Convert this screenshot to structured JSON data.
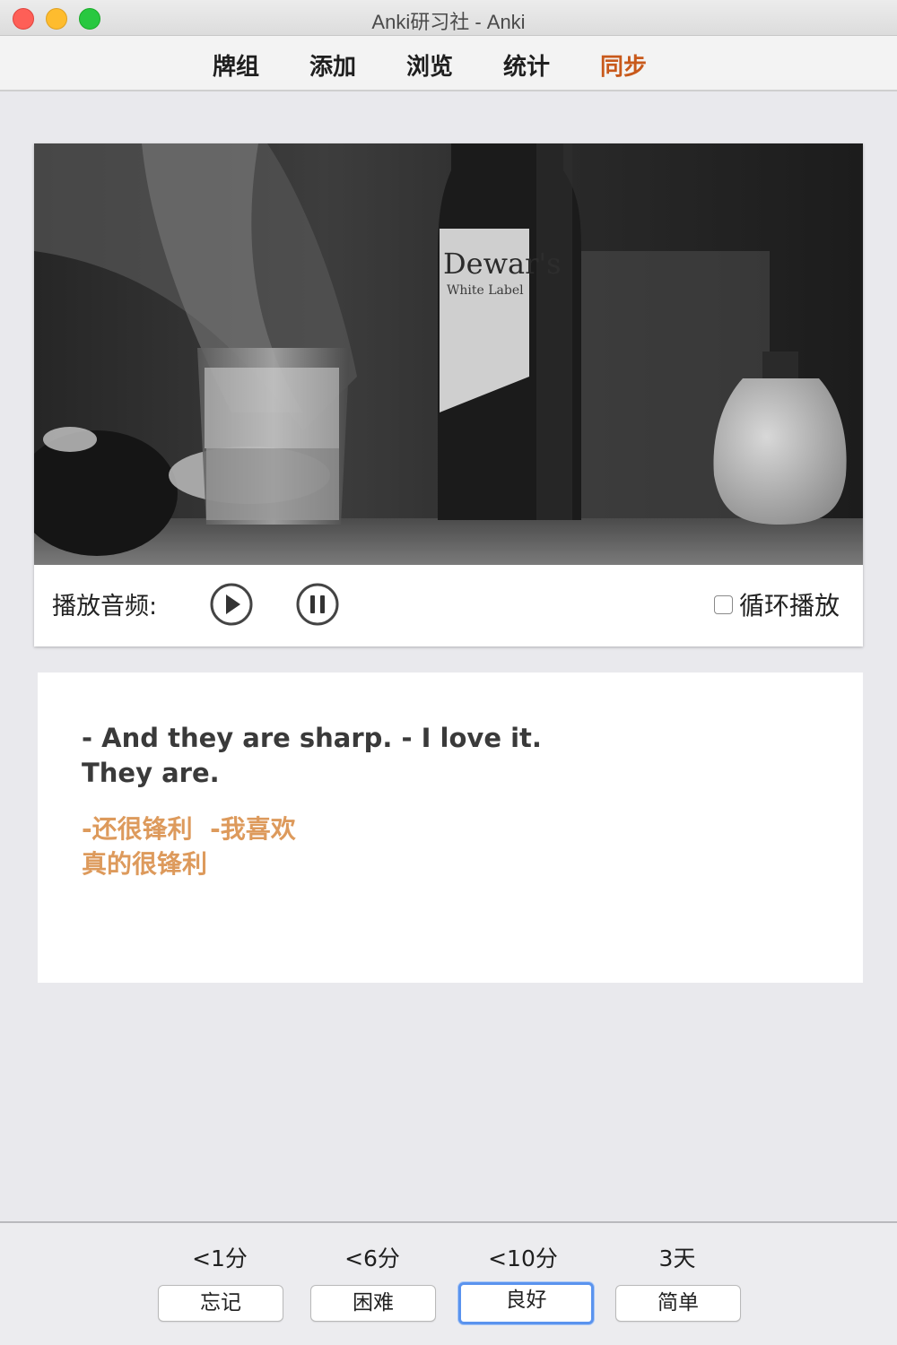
{
  "window": {
    "title": "Anki研习社 - Anki"
  },
  "toolbar": {
    "items": [
      {
        "label": "牌组"
      },
      {
        "label": "添加"
      },
      {
        "label": "浏览"
      },
      {
        "label": "统计"
      },
      {
        "label": "同步"
      }
    ],
    "active_color": "#c8591b"
  },
  "player": {
    "label": "播放音频:",
    "loop_label": "循环播放",
    "loop_checked": false,
    "play_icon": "play-circle-icon",
    "pause_icon": "pause-circle-icon",
    "bottle_label": "Dewar's",
    "bottle_sublabel": "White Label"
  },
  "card": {
    "english": [
      "- And they are sharp. - I love it.",
      "They are."
    ],
    "chinese": [
      "-还很锋利  -我喜欢",
      "真的很锋利"
    ],
    "chinese_color": "#dd9a5c"
  },
  "answers": [
    {
      "interval": "<1分",
      "label": "忘记"
    },
    {
      "interval": "<6分",
      "label": "困难"
    },
    {
      "interval": "<10分",
      "label": "良好",
      "focused": true
    },
    {
      "interval": "3天",
      "label": "简单"
    }
  ]
}
